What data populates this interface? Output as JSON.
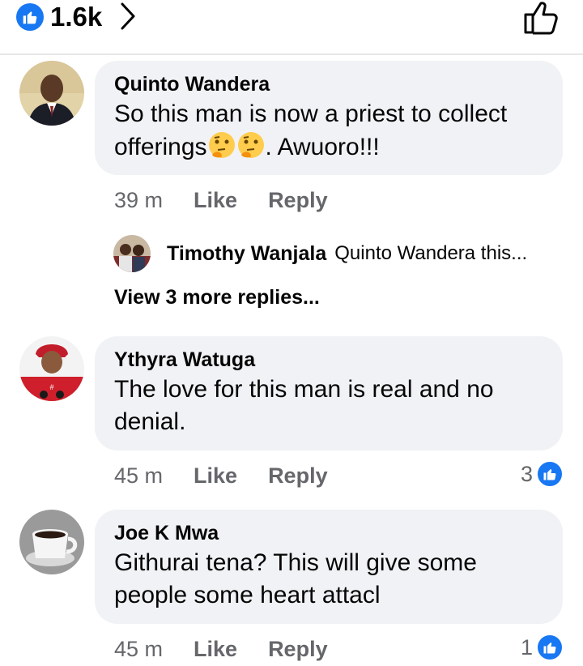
{
  "header": {
    "like_count": "1.6k",
    "brand_color": "#1877f2"
  },
  "comments": [
    {
      "author": "Quinto Wandera",
      "text_line1": "So this man is now a priest to collect",
      "text_line2_prefix": "offerings",
      "text_line2_suffix": ". Awuoro!!!",
      "emoji": "thinking-face",
      "age": "39 m",
      "like_label": "Like",
      "reply_label": "Reply"
    },
    {
      "author": "Ythyra Watuga",
      "text_line1": "The love for this man is real and no",
      "text_line2": "denial.",
      "age": "45 m",
      "like_label": "Like",
      "reply_label": "Reply",
      "reactions": "3"
    },
    {
      "author": "Joe K Mwa",
      "text_line1": "Githurai tena? This will give some",
      "text_line2": "people some heart attacl",
      "age": "45 m",
      "like_label": "Like",
      "reply_label": "Reply",
      "reactions": "1"
    }
  ],
  "reply_preview": {
    "author": "Timothy Wanjala",
    "snippet": "Quinto Wandera this..."
  },
  "view_more": "View 3 more replies...",
  "colors": {
    "bubble": "#f0f2f5",
    "secondary_text": "#65676b",
    "like_blue": "#1877f2"
  }
}
